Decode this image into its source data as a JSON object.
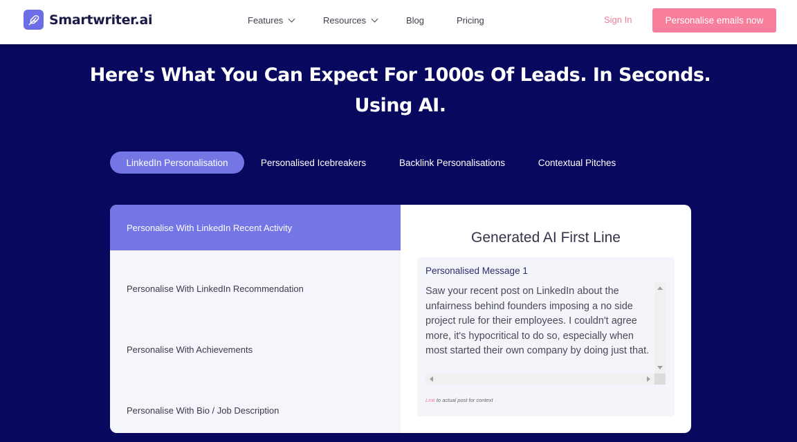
{
  "header": {
    "brand": "Smartwriter.ai",
    "logo_icon": "feather-icon",
    "nav": [
      {
        "label": "Features",
        "has_dropdown": true
      },
      {
        "label": "Resources",
        "has_dropdown": true
      },
      {
        "label": "Blog",
        "has_dropdown": false
      },
      {
        "label": "Pricing",
        "has_dropdown": false
      }
    ],
    "signin": "Sign In",
    "cta": "Personalise emails now"
  },
  "hero": {
    "line1": "Here's What You Can Expect For 1000s Of Leads. In Seconds.",
    "line2": "Using AI."
  },
  "tabs": [
    {
      "label": "LinkedIn Personalisation",
      "active": true
    },
    {
      "label": "Personalised Icebreakers",
      "active": false
    },
    {
      "label": "Backlink Personalisations",
      "active": false
    },
    {
      "label": "Contextual Pitches",
      "active": false
    }
  ],
  "options": [
    {
      "label": "Personalise With LinkedIn Recent Activity",
      "active": true
    },
    {
      "label": "Personalise With LinkedIn Recommendation",
      "active": false
    },
    {
      "label": "Personalise With Achievements",
      "active": false
    },
    {
      "label": "Personalise With Bio / Job Description",
      "active": false
    }
  ],
  "generated": {
    "title": "Generated AI First Line",
    "message_label": "Personalised Message 1",
    "message": "Saw your recent post on LinkedIn about the unfairness behind founders imposing a no side project rule for their employees. I couldn't agree more, it's hypocritical to do so, especially when most started their own company by doing just that.",
    "note_link": "Link",
    "note_rest": " to actual post for context"
  },
  "colors": {
    "background": "#07085e",
    "accent": "#7476e6",
    "cta": "#f87f9b",
    "signin": "#f07a98"
  }
}
